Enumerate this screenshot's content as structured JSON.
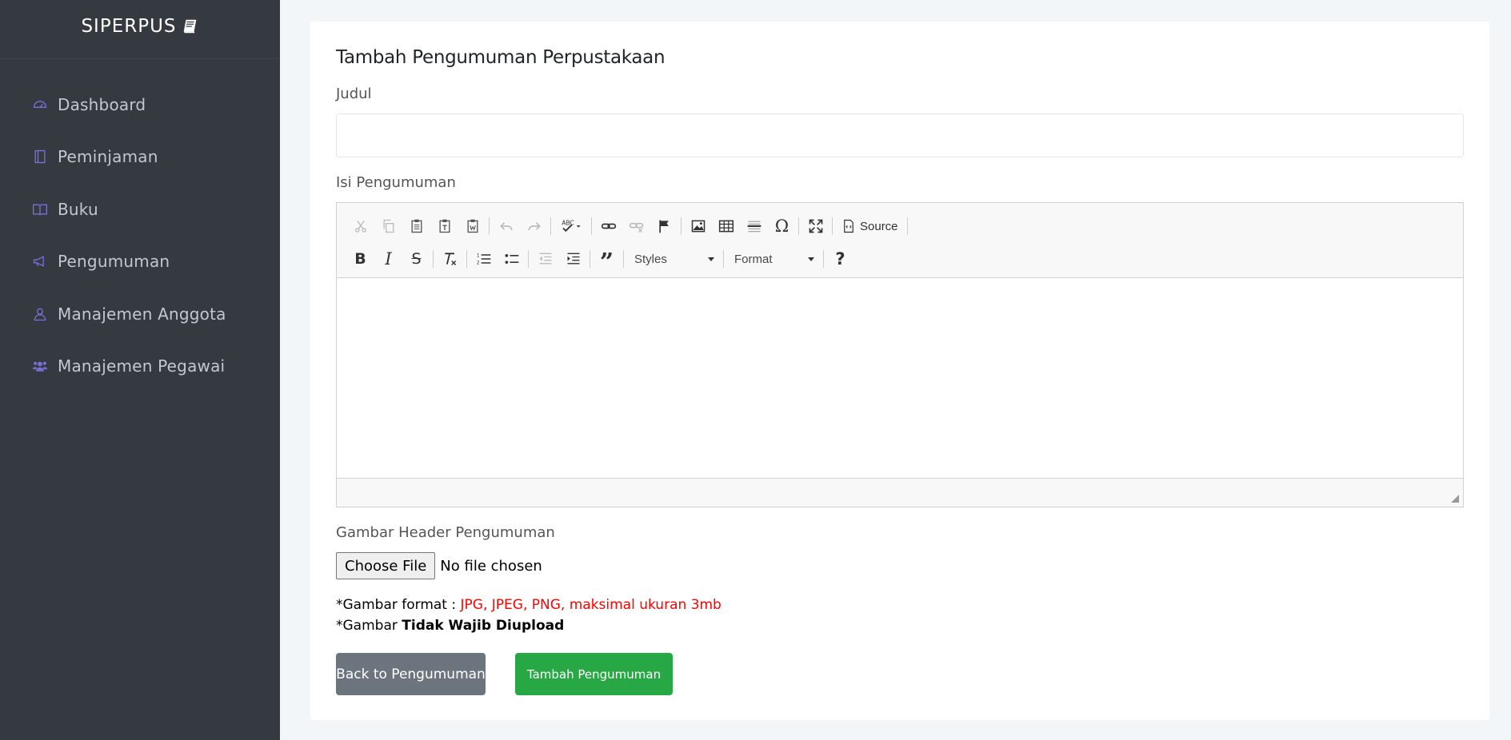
{
  "brand": {
    "name": "SIPERPUS"
  },
  "sidebar": {
    "items": [
      {
        "label": "Dashboard",
        "icon": "dashboard-icon"
      },
      {
        "label": "Peminjaman",
        "icon": "book-notebook-icon"
      },
      {
        "label": "Buku",
        "icon": "open-book-icon"
      },
      {
        "label": "Pengumuman",
        "icon": "megaphone-icon"
      },
      {
        "label": "Manajemen Anggota",
        "icon": "user-icon"
      },
      {
        "label": "Manajemen Pegawai",
        "icon": "users-icon"
      }
    ],
    "accent_color": "#7b6fd6"
  },
  "form": {
    "title": "Tambah Pengumuman Perpustakaan",
    "judul_label": "Judul",
    "judul_value": "",
    "isi_label": "Isi Pengumuman",
    "editor": {
      "source_label": "Source",
      "styles_label": "Styles",
      "format_label": "Format",
      "help_glyph": "?"
    },
    "gambar_label": "Gambar Header Pengumuman",
    "file_button": "Choose File",
    "file_status": "No file chosen",
    "note1_prefix": "*Gambar format : ",
    "note1_red": "JPG, JPEG, PNG, maksimal ukuran 3mb",
    "note2_prefix": "*Gambar ",
    "note2_bold": "Tidak Wajib Diupload"
  },
  "buttons": {
    "back": "Back to Pengumuman",
    "add": "Tambah Pengumuman"
  },
  "colors": {
    "sidebar_bg": "#343a40",
    "back_button": "#6c757d",
    "add_button": "#28a745",
    "note_red": "#ff0000"
  }
}
